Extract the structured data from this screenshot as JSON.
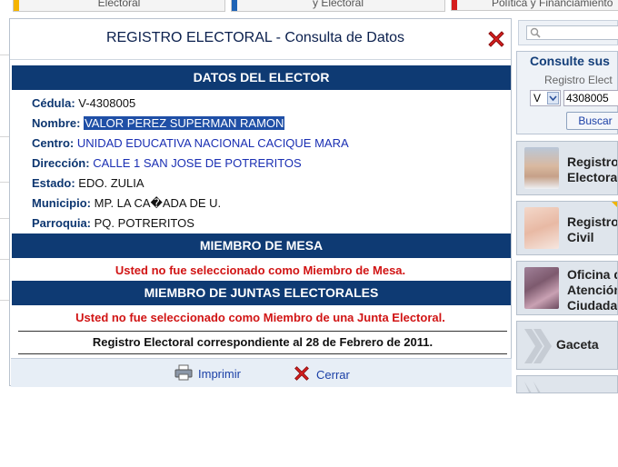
{
  "top_tabs": [
    {
      "label": "Electoral",
      "bar_color": "#f5b400"
    },
    {
      "label": "y Electoral",
      "bar_color": "#1e63b5"
    },
    {
      "label": "Política y Financiamiento",
      "bar_color": "#d41c1c"
    }
  ],
  "modal": {
    "title": "REGISTRO ELECTORAL - Consulta de Datos",
    "section_elector": "DATOS DEL ELECTOR",
    "fields": {
      "cedula": {
        "label": "Cédula:",
        "value": "V-4308005"
      },
      "nombre": {
        "label": "Nombre:",
        "value": "VALOR PEREZ SUPERMAN RAMON"
      },
      "centro": {
        "label": "Centro:",
        "value": "UNIDAD EDUCATIVA NACIONAL CACIQUE MARA"
      },
      "direccion": {
        "label": "Dirección:",
        "value": "CALLE 1 SAN JOSE DE POTRERITOS"
      },
      "estado": {
        "label": "Estado:",
        "value": "EDO. ZULIA"
      },
      "municipio": {
        "label": "Municipio:",
        "value": "MP. LA CA�ADA DE U."
      },
      "parroquia": {
        "label": "Parroquia:",
        "value": "PQ. POTRERITOS"
      }
    },
    "section_mesa": "MIEMBRO DE MESA",
    "msg_mesa": "Usted no fue seleccionado como Miembro de Mesa.",
    "section_juntas": "MIEMBRO DE JUNTAS ELECTORALES",
    "msg_juntas": "Usted no fue seleccionado como Miembro de una Junta Electoral.",
    "registro_note": "Registro Electoral correspondiente al 28 de Febrero de 2011.",
    "footer": {
      "print_label": "Imprimir",
      "close_label": "Cerrar"
    }
  },
  "sidebar": {
    "search_placeholder": "",
    "consult": {
      "title": "Consulte sus",
      "subtitle": "Registro Elect",
      "nationality": "V",
      "cedula_value": "4308005",
      "button": "Buscar"
    },
    "cards": [
      {
        "line1": "Registro",
        "line2": "Electora",
        "line3": ""
      },
      {
        "line1": "Registro",
        "line2": "Civil",
        "line3": ""
      },
      {
        "line1": "Oficina d",
        "line2": "Atención",
        "line3": "Ciudada"
      },
      {
        "line1": "Gaceta",
        "line2": "",
        "line3": ""
      }
    ]
  },
  "colors": {
    "header_bar": "#0e3a73",
    "alert": "#d11414",
    "link": "#1a3fa6"
  }
}
